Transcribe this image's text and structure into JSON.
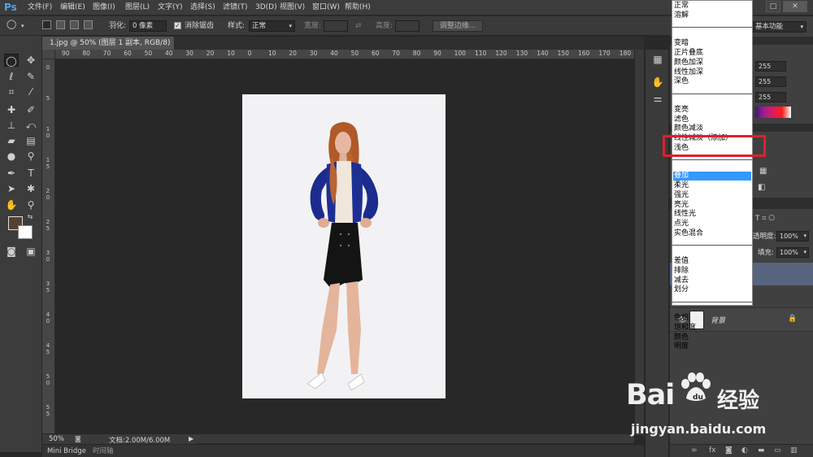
{
  "app": {
    "logo": "Ps"
  },
  "menubar": {
    "items": [
      "文件(F)",
      "编辑(E)",
      "图像(I)",
      "图层(L)",
      "文字(Y)",
      "选择(S)",
      "滤镜(T)",
      "3D(D)",
      "视图(V)",
      "窗口(W)",
      "帮助(H)"
    ]
  },
  "options": {
    "feather_label": "羽化:",
    "feather_value": "0 像素",
    "antialias_label": "消除锯齿",
    "style_label": "样式:",
    "style_value": "正常",
    "width_label": "宽度:",
    "height_label": "高度:",
    "refine_button": "调整边缘...",
    "workspace": "基本功能"
  },
  "document": {
    "tab_title": "1.jpg @ 50% (图层 1 副本, RGB/8) *",
    "zoom": "50%",
    "doc_info": "文档:2.00M/6.00M"
  },
  "ruler": {
    "h_labels": [
      "90",
      "80",
      "70",
      "60",
      "50",
      "40",
      "30",
      "20",
      "10",
      "0",
      "10",
      "20",
      "30",
      "40",
      "50",
      "60",
      "70",
      "80",
      "90",
      "100",
      "110",
      "120",
      "130",
      "140",
      "150",
      "160",
      "170",
      "180"
    ],
    "v_labels": [
      "0",
      "5",
      "1\n0",
      "1\n5",
      "2\n0",
      "2\n5",
      "3\n0",
      "3\n5",
      "4\n0",
      "4\n5",
      "5\n0",
      "5\n5"
    ]
  },
  "bottom_tabs": [
    "Mini Bridge",
    "时间轴"
  ],
  "blend_menu": {
    "groups": [
      [
        "正常",
        "溶解"
      ],
      [
        "变暗",
        "正片叠底",
        "颜色加深",
        "线性加深",
        "深色"
      ],
      [
        "变亮",
        "滤色",
        "颜色减淡",
        "线性减淡（添加）",
        "浅色"
      ],
      [
        "叠加",
        "柔光",
        "强光",
        "亮光",
        "线性光",
        "点光",
        "实色混合"
      ],
      [
        "差值",
        "排除",
        "减去",
        "划分"
      ],
      [
        "色相",
        "饱和度",
        "颜色",
        "明度"
      ]
    ],
    "selected": "叠加"
  },
  "right_panel": {
    "rgb_values": [
      "255",
      "255",
      "255"
    ],
    "opacity_label": "透明度:",
    "opacity_value": "100%",
    "fill_label": "填充:",
    "fill_value": "100%",
    "layer_name": "背景"
  },
  "watermark": {
    "logo": "Bai",
    "brand": "经验",
    "url": "jingyan.baidu.com"
  }
}
